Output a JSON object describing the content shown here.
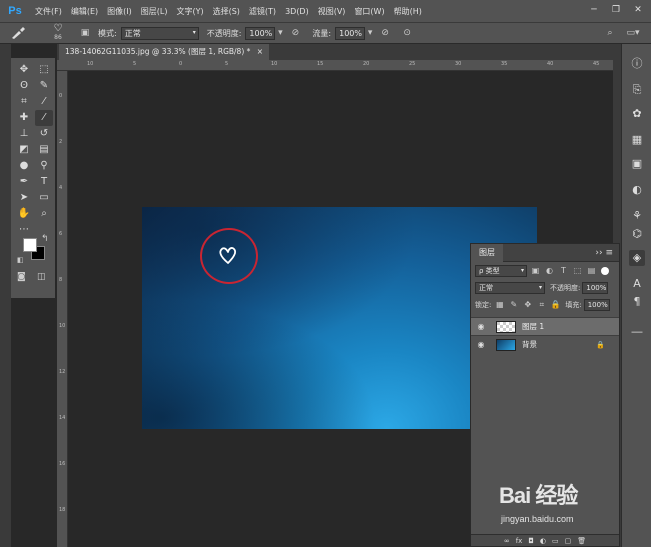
{
  "app": {
    "logo_text": "Ps",
    "menu": [
      "文件(F)",
      "编辑(E)",
      "图像(I)",
      "图层(L)",
      "文字(Y)",
      "选择(S)",
      "滤镜(T)",
      "3D(D)",
      "视图(V)",
      "窗口(W)",
      "帮助(H)"
    ],
    "window_controls": [
      "─",
      "❐",
      "✕"
    ]
  },
  "options_bar": {
    "brush_size": "86",
    "mode_label": "模式:",
    "mode_value": "正常",
    "opacity_label": "不透明度:",
    "opacity_value": "100%",
    "flow_label": "流量:",
    "flow_value": "100%"
  },
  "document": {
    "tab_title": "138-14062G11035.jpg @ 33.3% (图层 1, RGB/8) *",
    "close": "×",
    "ruler_top": [
      "10",
      "5",
      "0",
      "5",
      "10",
      "15",
      "20",
      "25",
      "30",
      "35",
      "40",
      "45"
    ],
    "ruler_left": [
      "0",
      "2",
      "4",
      "6",
      "8",
      "10",
      "12",
      "14",
      "16",
      "18"
    ]
  },
  "layers_panel": {
    "tab_label": "图层",
    "filter_kind": "ρ 类型",
    "blend_mode": "正常",
    "opacity_label": "不透明度:",
    "opacity_value": "100%",
    "lock_label": "锁定:",
    "fill_label": "填充:",
    "fill_value": "100%",
    "layers": [
      {
        "name": "图层 1",
        "selected": true,
        "thumb": "transparent"
      },
      {
        "name": "背景",
        "selected": false,
        "thumb": "blue",
        "locked": true
      }
    ],
    "footer_icons": [
      "∞",
      "fx",
      "◘",
      "◐",
      "▭",
      "▢",
      "🗑"
    ]
  },
  "watermark": {
    "title": "Bai 经验",
    "subtitle": "jingyan.baidu.com"
  },
  "colors": {
    "foreground": "#ffffff",
    "background": "#000000",
    "accent_circle": "#c92532"
  }
}
